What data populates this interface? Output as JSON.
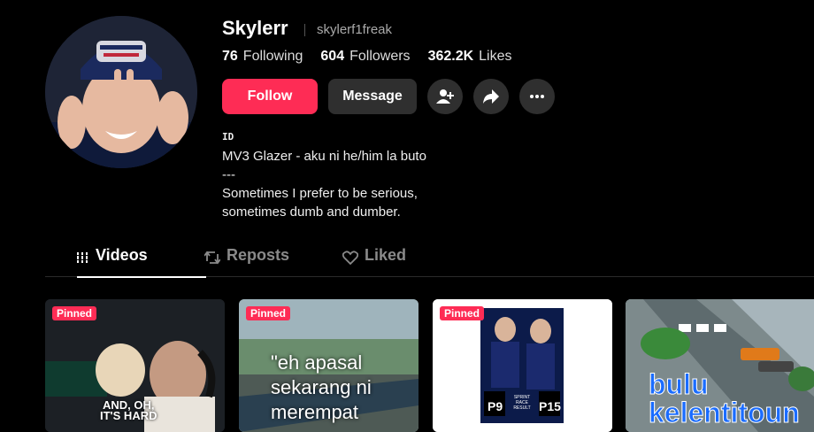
{
  "profile": {
    "username": "Skylerr",
    "handle": "skylerf1freak",
    "stats": [
      {
        "value": "76",
        "label": "Following"
      },
      {
        "value": "604",
        "label": "Followers"
      },
      {
        "value": "362.2K",
        "label": "Likes"
      }
    ],
    "follow_label": "Follow",
    "message_label": "Message",
    "bio": {
      "line1": "ID",
      "line2": "MV3 Glazer - aku ni he/him la buto",
      "line3": "---",
      "line4": "Sometimes I prefer to be serious,",
      "line5": "sometimes dumb and dumber."
    }
  },
  "tabs": [
    {
      "label": "Videos",
      "icon": "grid-icon",
      "active": true
    },
    {
      "label": "Reposts",
      "icon": "repost-icon",
      "active": false
    },
    {
      "label": "Liked",
      "icon": "heart-icon",
      "active": false
    }
  ],
  "videos": [
    {
      "badge": "Pinned",
      "caption": "AND, OH,\nIT'S HARD"
    },
    {
      "badge": "Pinned",
      "caption": "\"eh apasal\nsekarang ni\nmerempat"
    },
    {
      "badge": "Pinned",
      "caption": "",
      "inner": {
        "label1": "P9",
        "label2": "P15",
        "center": "SPRINT RACE RESULT"
      }
    },
    {
      "badge": "",
      "caption": "bulu\nkelentitoun"
    }
  ],
  "colors": {
    "accent": "#fe2c55",
    "background": "#000000",
    "button": "#2f2f2f"
  }
}
